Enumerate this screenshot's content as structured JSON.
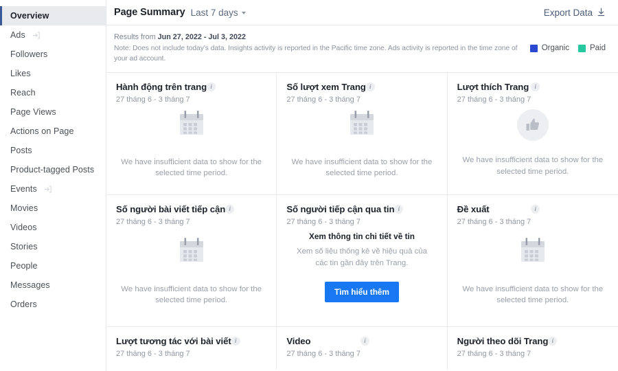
{
  "sidebar": {
    "items": [
      {
        "label": "Overview",
        "active": true,
        "external": false
      },
      {
        "label": "Ads",
        "active": false,
        "external": true
      },
      {
        "label": "Followers",
        "active": false,
        "external": false
      },
      {
        "label": "Likes",
        "active": false,
        "external": false
      },
      {
        "label": "Reach",
        "active": false,
        "external": false
      },
      {
        "label": "Page Views",
        "active": false,
        "external": false
      },
      {
        "label": "Actions on Page",
        "active": false,
        "external": false
      },
      {
        "label": "Posts",
        "active": false,
        "external": false
      },
      {
        "label": "Product-tagged Posts",
        "active": false,
        "external": false
      },
      {
        "label": "Events",
        "active": false,
        "external": true
      },
      {
        "label": "Movies",
        "active": false,
        "external": false
      },
      {
        "label": "Videos",
        "active": false,
        "external": false
      },
      {
        "label": "Stories",
        "active": false,
        "external": false
      },
      {
        "label": "People",
        "active": false,
        "external": false
      },
      {
        "label": "Messages",
        "active": false,
        "external": false
      },
      {
        "label": "Orders",
        "active": false,
        "external": false
      }
    ]
  },
  "header": {
    "title": "Page Summary",
    "date_range": "Last 7 days",
    "export_label": "Export Data",
    "export_icon": "download-icon",
    "caret_icon": "chevron-down-icon"
  },
  "notice": {
    "results_prefix": "Results from ",
    "results_dates": "Jun 27, 2022 - Jul 3, 2022",
    "note": "Note: Does not include today's data. Insights activity is reported in the Pacific time zone. Ads activity is reported in the time zone of your ad account.",
    "legend": [
      {
        "label": "Organic",
        "color": "#2b48d0"
      },
      {
        "label": "Paid",
        "color": "#27c7a0"
      }
    ]
  },
  "cards": [
    {
      "title": "Hành động trên trang",
      "subtitle": "27 tháng 6 - 3 tháng 7",
      "state": "empty",
      "icon": "calendar-icon",
      "empty_text": "We have insufficient data to show for the selected time period."
    },
    {
      "title": "Số lượt xem Trang",
      "subtitle": "27 tháng 6 - 3 tháng 7",
      "state": "empty",
      "icon": "calendar-icon",
      "empty_text": "We have insufficient data to show for the selected time period."
    },
    {
      "title": "Lượt thích Trang",
      "subtitle": "27 tháng 6 - 3 tháng 7",
      "state": "empty",
      "icon": "thumbs-up-icon",
      "empty_text": "We have insufficient data to show for the selected time period."
    },
    {
      "title": "Số người bài viết tiếp cận",
      "subtitle": "27 tháng 6 - 3 tháng 7",
      "state": "empty",
      "icon": "calendar-icon",
      "empty_text": "We have insufficient data to show for the selected time period."
    },
    {
      "title": "Số người tiếp cận qua tin",
      "subtitle": "27 tháng 6 - 3 tháng 7",
      "state": "cta",
      "cta_title": "Xem thông tin chi tiết về tin",
      "cta_desc": "Xem số liệu thống kê về hiệu quả của các tin gần đây trên Trang.",
      "cta_button": "Tìm hiểu thêm"
    },
    {
      "title": "Đề xuất",
      "subtitle": "27 tháng 6 - 3 tháng 7",
      "state": "empty",
      "icon": "calendar-icon",
      "empty_text": "We have insufficient data to show for the selected time period."
    },
    {
      "title": "Lượt tương tác với bài viết",
      "subtitle": "27 tháng 6 - 3 tháng 7",
      "state": "partial"
    },
    {
      "title": "Video",
      "subtitle": "27 tháng 6 - 3 tháng 7",
      "state": "partial"
    },
    {
      "title": "Người theo dõi Trang",
      "subtitle": "27 tháng 6 - 3 tháng 7",
      "state": "partial"
    }
  ]
}
